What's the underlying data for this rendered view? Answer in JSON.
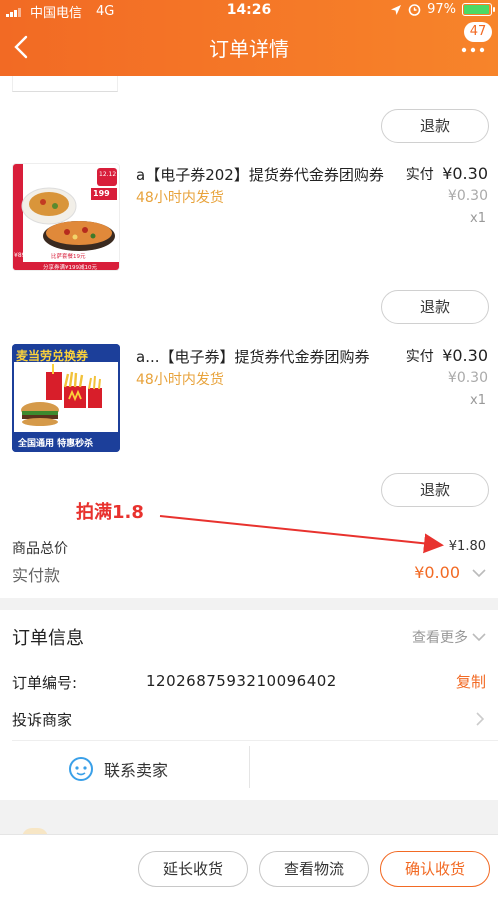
{
  "status_bar": {
    "carrier": "中国电信",
    "network": "4G",
    "time": "14:26",
    "battery_pct": "97%",
    "battery_level": 0.97
  },
  "header": {
    "title": "订单详情",
    "badge": "47"
  },
  "refund_label": "退款",
  "items": [
    {
      "title": "a【电子券202】提货券代金券团购券",
      "subtitle": "48小时内发货",
      "real_label": "实付",
      "real_price": "¥0.30",
      "orig_price": "¥0.30",
      "qty": "x1",
      "img_text": {
        "tag": "12.12",
        "price": "199",
        "promo": "比萨套餐19元",
        "foot": "分享券满¥199减10元",
        "small": "¥89"
      }
    },
    {
      "title": "a...【电子券】提货券代金券团购券",
      "subtitle": "48小时内发货",
      "real_label": "实付",
      "real_price": "¥0.30",
      "orig_price": "¥0.30",
      "qty": "x1",
      "img_text": {
        "top": "麦当劳兑换券",
        "bottom": "全国通用 特惠秒杀"
      }
    }
  ],
  "summary": {
    "goods_total_label": "商品总价",
    "goods_total": "¥1.80",
    "paid_label": "实付款",
    "paid": "¥0.00"
  },
  "annotation": {
    "text": "拍满1.8",
    "color": "#e8322e"
  },
  "order_info": {
    "title": "订单信息",
    "view_more": "查看更多",
    "order_no_label": "订单编号:",
    "order_no": "1202687593210096402",
    "copy_label": "复制",
    "complaint_label": "投诉商家",
    "contact_label": "联系卖家"
  },
  "bottom_bar": {
    "extend": "延长收货",
    "logistics": "查看物流",
    "confirm": "确认收货"
  },
  "colors": {
    "brand": "#f26a24",
    "accent_yellow": "#e8a33c"
  }
}
